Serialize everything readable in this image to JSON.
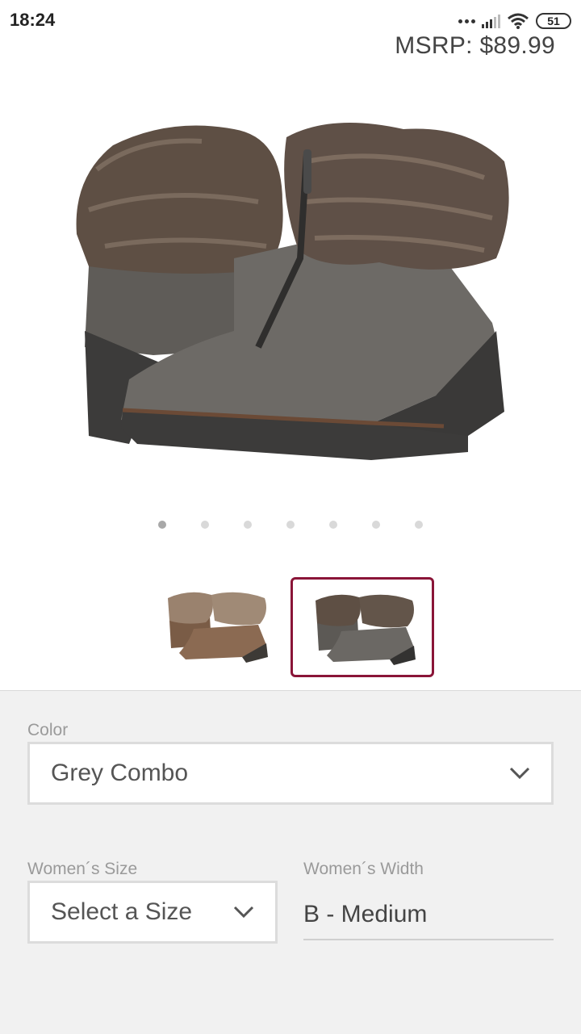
{
  "status": {
    "time": "18:24",
    "battery": "51"
  },
  "product": {
    "msrp": "MSRP: $89.99"
  },
  "gallery": {
    "page_count": 7,
    "active_page": 1
  },
  "thumbnails": [
    {
      "name": "brown-variant",
      "selected": false
    },
    {
      "name": "grey-variant",
      "selected": true
    }
  ],
  "options": {
    "color_label": "Color",
    "color_value": "Grey Combo",
    "size_label": "Women´s Size",
    "size_value": "Select a Size",
    "width_label": "Women´s Width",
    "width_value": "B - Medium"
  },
  "colors": {
    "accent": "#8a1538",
    "panel_bg": "#f1f1f1"
  }
}
